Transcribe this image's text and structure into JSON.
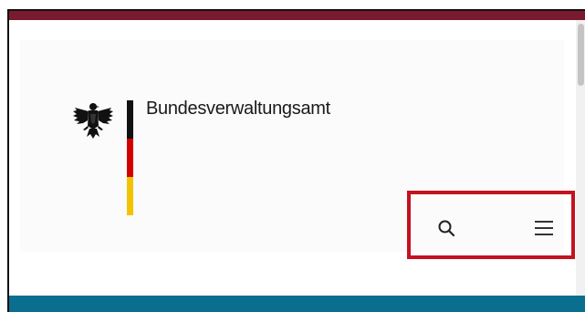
{
  "header": {
    "agency_name": "Bundesverwaltungsamt",
    "flag_colors": [
      "#111111",
      "#d40000",
      "#f2c300"
    ],
    "accent_top": "#7a1a30",
    "accent_bottom": "#0a6f8f"
  },
  "actions": {
    "search_icon": "search-icon",
    "menu_icon": "hamburger-menu-icon",
    "highlight_color": "#c4121f"
  }
}
